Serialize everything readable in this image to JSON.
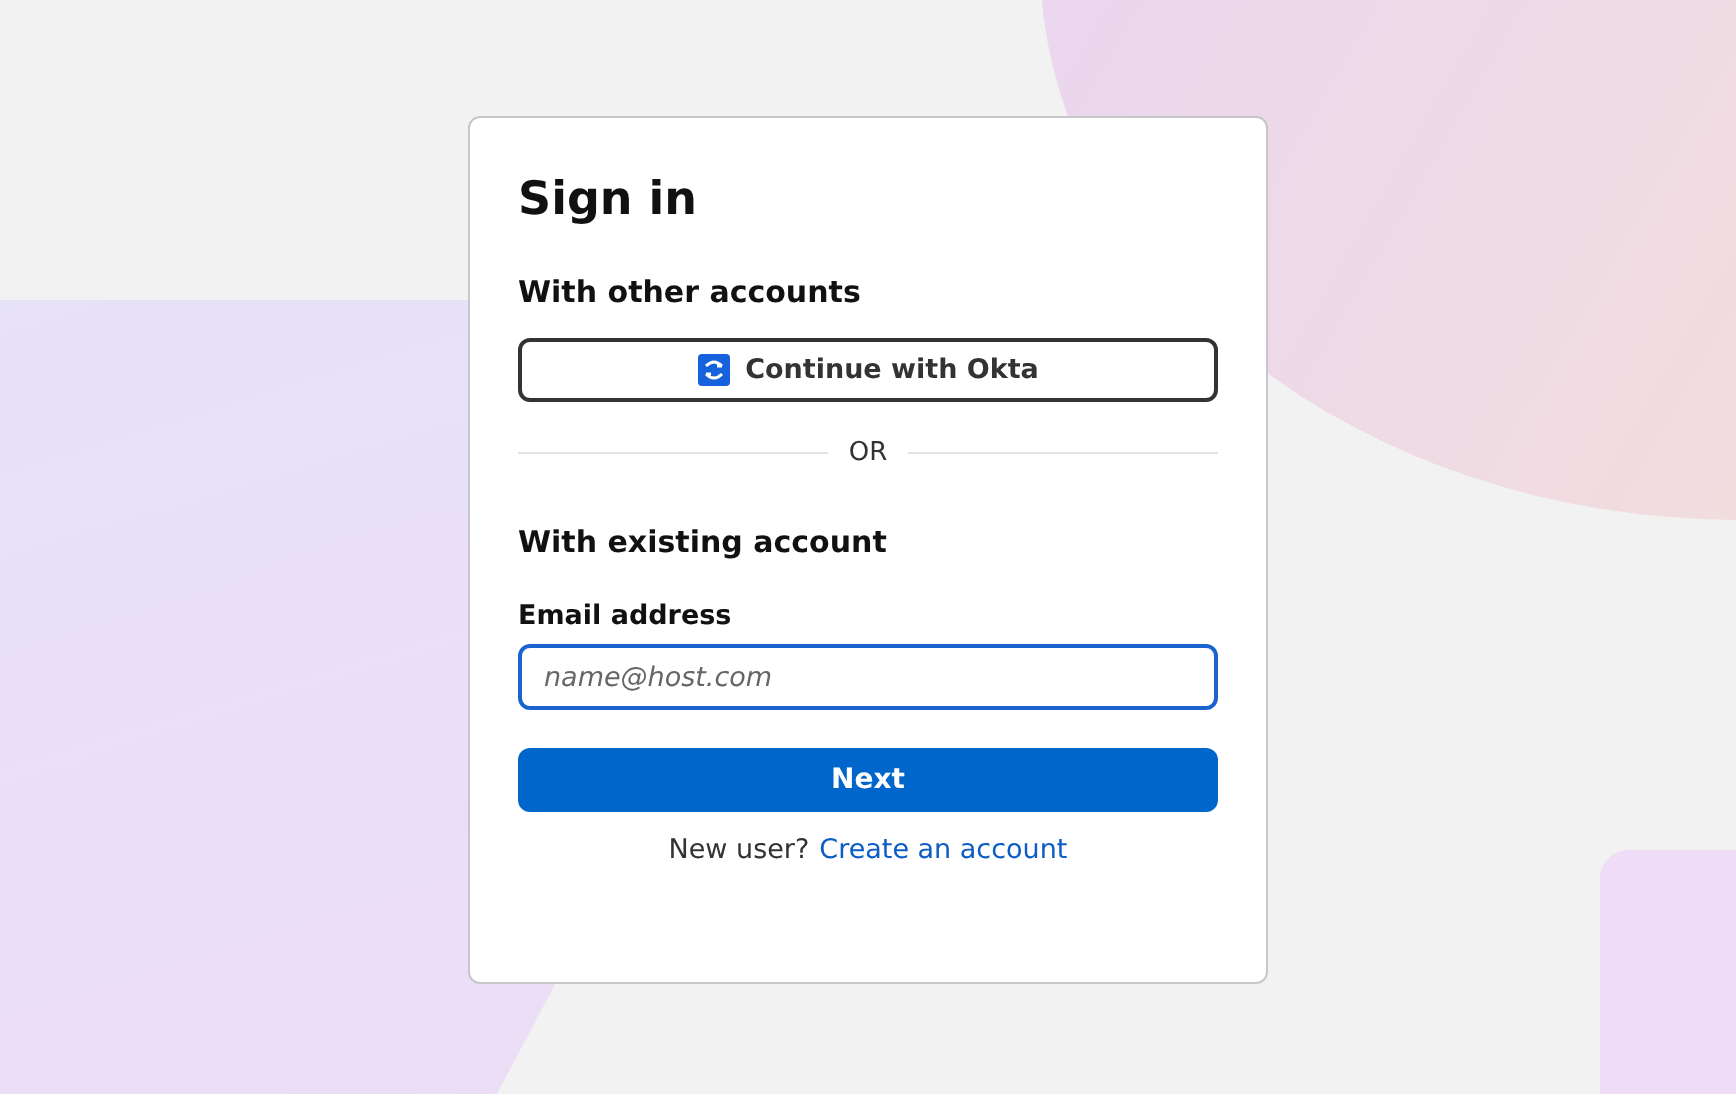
{
  "title": "Sign in",
  "other_accounts": {
    "heading": "With other accounts",
    "button": "Continue with Okta"
  },
  "divider": "OR",
  "existing_account": {
    "heading": "With existing account",
    "email_label": "Email address",
    "email_placeholder": "name@host.com",
    "submit": "Next"
  },
  "footer": {
    "prompt": "New user?",
    "link": "Create an account"
  }
}
